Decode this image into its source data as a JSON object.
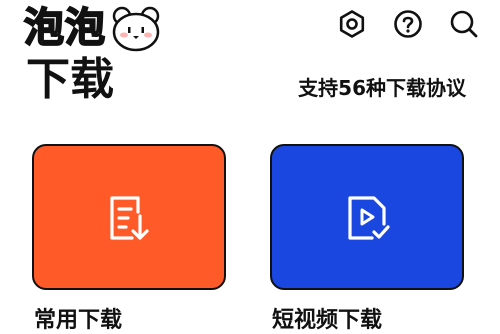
{
  "app": {
    "logo_text": "泡泡",
    "page_title": "下载",
    "protocol_note": "支持56种下载协议"
  },
  "header": {
    "icons": [
      "settings-icon",
      "help-icon",
      "search-icon"
    ]
  },
  "cards": [
    {
      "label": "常用下载",
      "icon": "document-download-icon",
      "color": "#ff5a28"
    },
    {
      "label": "短视频下载",
      "icon": "video-file-check-icon",
      "color": "#1a47e0"
    }
  ]
}
